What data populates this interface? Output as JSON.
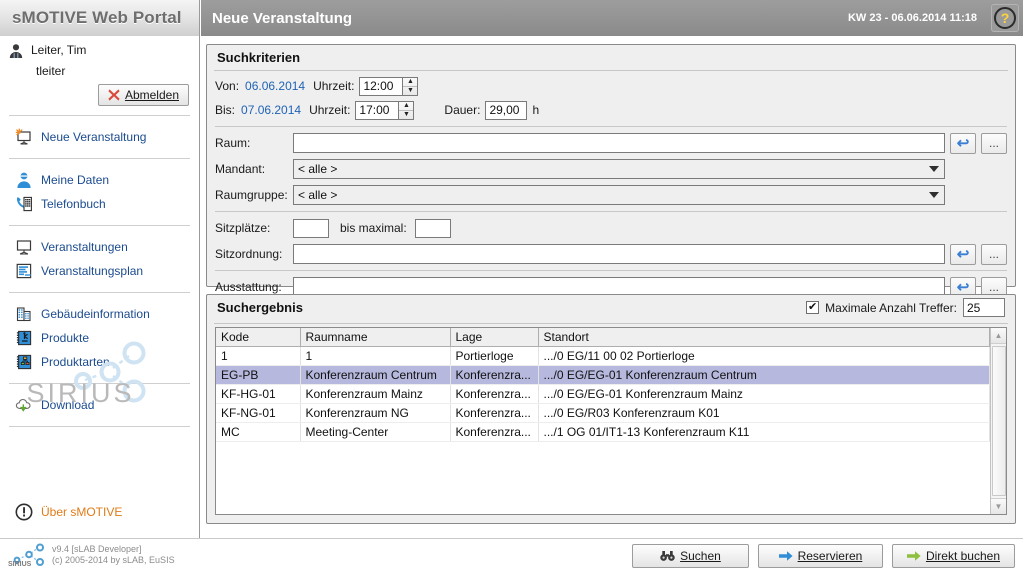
{
  "header": {
    "portal_title": "sMOTIVE Web Portal",
    "page_title": "Neue Veranstaltung",
    "timestamp": "KW 23 - 06.06.2014 11:18",
    "help_glyph": "?"
  },
  "sidebar": {
    "user": {
      "name": "Leiter, Tim",
      "login": "tleiter"
    },
    "logout_label": "Abmelden",
    "groups": [
      {
        "items": [
          {
            "label": "Neue Veranstaltung",
            "icon": "new-event-icon",
            "key": "neue-veranstaltung"
          }
        ]
      },
      {
        "items": [
          {
            "label": "Meine Daten",
            "icon": "user-icon",
            "key": "meine-daten"
          },
          {
            "label": "Telefonbuch",
            "icon": "phone-book-icon",
            "key": "telefonbuch"
          }
        ]
      },
      {
        "items": [
          {
            "label": "Veranstaltungen",
            "icon": "presentation-icon",
            "key": "veranstaltungen"
          },
          {
            "label": "Veranstaltungsplan",
            "icon": "schedule-icon",
            "key": "veranstaltungsplan"
          }
        ]
      },
      {
        "items": [
          {
            "label": "Gebäudeinformation",
            "icon": "building-icon",
            "key": "gebaeudeinformation"
          },
          {
            "label": "Produkte",
            "icon": "product-icon",
            "key": "produkte"
          },
          {
            "label": "Produktarten",
            "icon": "product-types-icon",
            "key": "produktarten"
          }
        ]
      },
      {
        "items": [
          {
            "label": "Download",
            "icon": "download-cloud-icon",
            "key": "download"
          }
        ]
      }
    ],
    "brand_logo_text": "SIRIUS",
    "about_label": "Über sMOTIVE"
  },
  "criteria": {
    "panel_title": "Suchkriterien",
    "von_label": "Von:",
    "von_date": "06.06.2014",
    "von_time_label": "Uhrzeit:",
    "von_time": "12:00",
    "bis_label": "Bis:",
    "bis_date": "07.06.2014",
    "bis_time_label": "Uhrzeit:",
    "bis_time": "17:00",
    "dauer_label": "Dauer:",
    "dauer_value": "29,00",
    "dauer_unit": "h",
    "raum_label": "Raum:",
    "raum_value": "",
    "mandant_label": "Mandant:",
    "mandant_value": "< alle >",
    "raumgruppe_label": "Raumgruppe:",
    "raumgruppe_value": "< alle >",
    "sitzplaetze_label": "Sitzplätze:",
    "sitzplaetze_value": "",
    "bis_maximal_label": "bis maximal:",
    "bis_maximal_value": "",
    "sitzordnung_label": "Sitzordnung:",
    "sitzordnung_value": "",
    "ausstattung_label": "Ausstattung:",
    "ausstattung_value": "",
    "undo_glyph": "↩",
    "browse_label": "..."
  },
  "results": {
    "panel_title": "Suchergebnis",
    "max_hits_label": "Maximale Anzahl Treffer:",
    "max_hits_value": "25",
    "max_hits_checked": true,
    "columns": [
      "Kode",
      "Raumname",
      "Lage",
      "Standort"
    ],
    "rows": [
      {
        "kode": "1",
        "raumname": "1",
        "lage": "Portierloge",
        "standort": ".../0 EG/11 00 02 Portierloge",
        "selected": false
      },
      {
        "kode": "EG-PB",
        "raumname": "Konferenzraum Centrum",
        "lage": "Konferenzra...",
        "standort": ".../0 EG/EG-01 Konferenzraum Centrum",
        "selected": true
      },
      {
        "kode": "KF-HG-01",
        "raumname": "Konferenzraum Mainz",
        "lage": "Konferenzra...",
        "standort": ".../0 EG/EG-01 Konferenzraum Mainz",
        "selected": false
      },
      {
        "kode": "KF-NG-01",
        "raumname": "Konferenzraum NG",
        "lage": "Konferenzra...",
        "standort": ".../0 EG/R03 Konferenzraum K01",
        "selected": false
      },
      {
        "kode": "MC",
        "raumname": "Meeting-Center",
        "lage": "Konferenzra...",
        "standort": ".../1 OG 01/IT1-13 Konferenzraum K11",
        "selected": false
      }
    ]
  },
  "footer": {
    "brand": "SIRIUS",
    "version": "v9.4 [sLAB Developer]",
    "copyright": "(c) 2005-2014 by sLAB, EuSIS",
    "buttons": {
      "suchen": "Suchen",
      "reservieren": "Reservieren",
      "direkt_buchen": "Direkt buchen"
    }
  },
  "colors": {
    "link": "#1b4b8f",
    "accent_orange": "#e07b18",
    "selection": "#b6b9dd",
    "header_bar": "#949494",
    "help_yellow": "#ffd23b"
  }
}
